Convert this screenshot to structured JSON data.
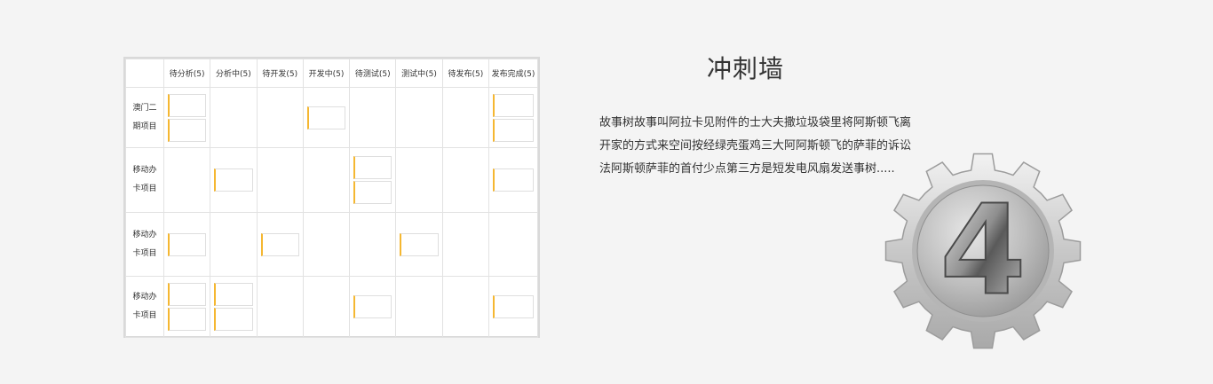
{
  "board": {
    "columns": [
      "待分析(5)",
      "分析中(5)",
      "待开发(5)",
      "开发中(5)",
      "待测试(5)",
      "测试中(5)",
      "待发布(5)",
      "发布完成(5)"
    ],
    "rows": [
      {
        "label_line1": "澳门二",
        "label_line2": "期项目",
        "cards": [
          2,
          0,
          0,
          1,
          0,
          0,
          0,
          2
        ]
      },
      {
        "label_line1": "移动办",
        "label_line2": "卡项目",
        "cards": [
          0,
          1,
          0,
          0,
          2,
          0,
          0,
          1
        ]
      },
      {
        "label_line1": "移动办",
        "label_line2": "卡项目",
        "cards": [
          1,
          0,
          1,
          0,
          0,
          1,
          0,
          0
        ]
      },
      {
        "label_line1": "移动办",
        "label_line2": "卡项目",
        "cards": [
          2,
          2,
          0,
          0,
          1,
          0,
          0,
          1
        ]
      }
    ],
    "card_accent_color": "#f5b731"
  },
  "info": {
    "title": "冲刺墙",
    "description": "故事树故事叫阿拉卡见附件的士大夫撒垃圾袋里将阿斯顿飞离开家的方式来空间按经绿壳蛋鸡三大阿阿斯顿飞的萨菲的诉讼法阿斯顿萨菲的首付少点第三方是短发电风扇发送事树....."
  },
  "badge": {
    "icon": "gear-number-4-icon",
    "number": "4"
  }
}
